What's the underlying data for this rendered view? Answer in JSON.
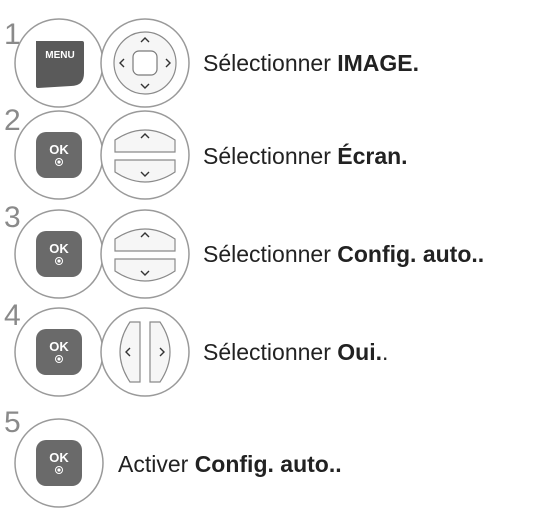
{
  "steps": [
    {
      "number": "1",
      "left_button_icon": "menu-button-icon",
      "left_button_label": "MENU",
      "right_button_icon": "dpad-navigation-icon",
      "text": "Sélectionner ",
      "bold": "IMAGE.",
      "tail": ""
    },
    {
      "number": "2",
      "left_button_icon": "ok-button-icon",
      "left_button_label": "OK",
      "right_button_icon": "up-down-buttons-icon",
      "text": "Sélectionner ",
      "bold": "Écran.",
      "tail": ""
    },
    {
      "number": "3",
      "left_button_icon": "ok-button-icon",
      "left_button_label": "OK",
      "right_button_icon": "up-down-buttons-icon",
      "text": "Sélectionner ",
      "bold": "Config. auto..",
      "tail": ""
    },
    {
      "number": "4",
      "left_button_icon": "ok-button-icon",
      "left_button_label": "OK",
      "right_button_icon": "left-right-buttons-icon",
      "text": "Sélectionner ",
      "bold": "Oui.",
      "tail": "."
    },
    {
      "number": "5",
      "left_button_icon": "ok-button-icon",
      "left_button_label": "OK",
      "text": "Activer ",
      "bold": "Config. auto..",
      "tail": ""
    }
  ]
}
